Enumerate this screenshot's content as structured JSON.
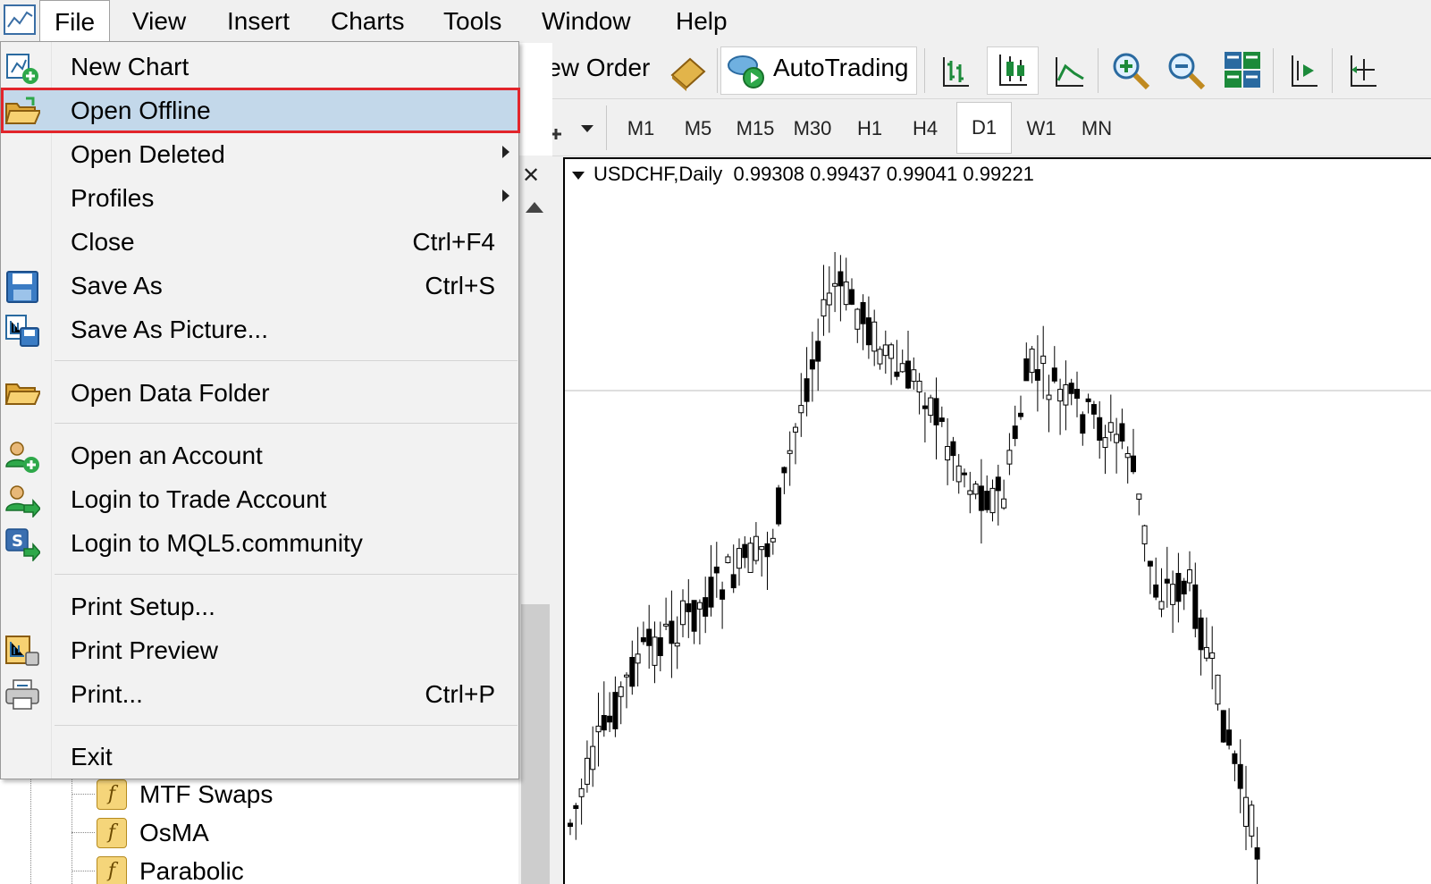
{
  "menubar": {
    "items": [
      "File",
      "View",
      "Insert",
      "Charts",
      "Tools",
      "Window",
      "Help"
    ]
  },
  "toolbar": {
    "new_order": "New Order",
    "autotrading": "AutoTrading"
  },
  "timeframes": [
    "M1",
    "M5",
    "M15",
    "M30",
    "H1",
    "H4",
    "D1",
    "W1",
    "MN"
  ],
  "active_timeframe": "D1",
  "file_menu": {
    "items": [
      {
        "label": "New Chart",
        "shortcut": "",
        "icon": "new-chart-icon"
      },
      {
        "label": "Open Offline",
        "shortcut": "",
        "icon": "open-folder-icon",
        "highlighted": true
      },
      {
        "label": "Open Deleted",
        "shortcut": "",
        "submenu": true
      },
      {
        "label": "Profiles",
        "shortcut": "",
        "submenu": true
      },
      {
        "label": "Close",
        "shortcut": "Ctrl+F4"
      },
      {
        "label": "Save As",
        "shortcut": "Ctrl+S",
        "icon": "save-icon"
      },
      {
        "label": "Save As Picture...",
        "shortcut": "",
        "icon": "save-picture-icon"
      },
      {
        "label": "Open Data Folder",
        "shortcut": "",
        "icon": "folder-icon"
      },
      {
        "label": "Open an Account",
        "shortcut": "",
        "icon": "add-user-icon"
      },
      {
        "label": "Login to Trade Account",
        "shortcut": "",
        "icon": "login-user-icon"
      },
      {
        "label": "Login to MQL5.community",
        "shortcut": "",
        "icon": "mql5-login-icon"
      },
      {
        "label": "Print Setup...",
        "shortcut": ""
      },
      {
        "label": "Print Preview",
        "shortcut": "",
        "icon": "print-preview-icon"
      },
      {
        "label": "Print...",
        "shortcut": "Ctrl+P",
        "icon": "printer-icon"
      },
      {
        "label": "Exit",
        "shortcut": ""
      }
    ]
  },
  "navigator": {
    "items": [
      "MTF Swaps",
      "OsMA",
      "Parabolic"
    ]
  },
  "chart": {
    "symbol_period": "USDCHF,Daily",
    "ohlc": "0.99308 0.99437 0.99041 0.99221"
  },
  "colors": {
    "highlight": "#c3d8ea",
    "annotation_box": "#e2252b"
  }
}
